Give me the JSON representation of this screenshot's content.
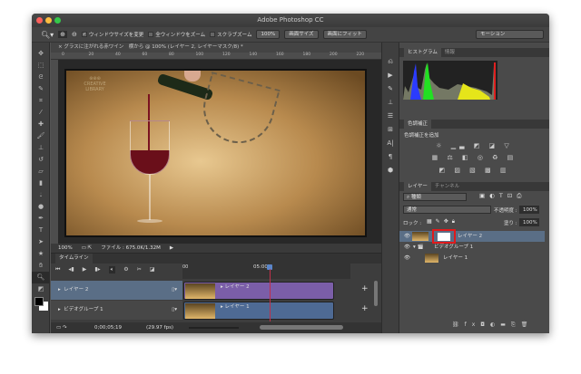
{
  "app_title": "Adobe Photoshop CC",
  "options": {
    "resize_windows": "ウィンドウサイズを変更",
    "zoom_all": "全ウィンドウをズーム",
    "scrubby_zoom": "スクラブズーム",
    "zoom_100": "100%",
    "fit_screen": "画面サイズ",
    "fill_screen": "画面にフィット",
    "workspace": "モーション"
  },
  "document": {
    "tab": "グラスに注がれる赤ワイン　横から @ 100% (レイヤー 2, レイヤーマスク/8) *",
    "ruler_ticks": [
      "0",
      "20",
      "40",
      "60",
      "80",
      "100",
      "120",
      "140",
      "160",
      "180",
      "200",
      "220"
    ],
    "watermark": "CREATIVE LIBRARY",
    "zoom": "100%",
    "file_info": "ファイル : 675.0K/1.32M"
  },
  "timeline": {
    "tab": "タイムライン",
    "time_marker": "05:00",
    "start_marker": "00",
    "tracks": [
      {
        "name": "レイヤー 2",
        "clip": "レイヤー 2",
        "color": "#7b5ea8"
      },
      {
        "name": "ビデオグループ 1",
        "clip": "レイヤー 1",
        "color": "#4e6a94"
      }
    ],
    "timecode": "0;00;05;19",
    "fps": "(29.97 fps)"
  },
  "histogram": {
    "tabs": [
      "ヒストグラム",
      "情報"
    ]
  },
  "adjustments": {
    "tab": "色調補正",
    "add_label": "色調補正を追加"
  },
  "layers": {
    "tabs": [
      "レイヤー",
      "チャンネル"
    ],
    "filter": "種類",
    "blend_mode": "通常",
    "opacity_label": "不透明度 :",
    "opacity": "100%",
    "lock_label": "ロック :",
    "fill_label": "塗り :",
    "fill": "100%",
    "items": [
      {
        "name": "レイヤー 2"
      },
      {
        "name": "ビデオグループ 1"
      },
      {
        "name": "レイヤー 1"
      }
    ]
  },
  "colors": {
    "selected_layer": "#5a6e86",
    "playhead": "#c0304a",
    "mask_highlight": "#e0191b"
  }
}
